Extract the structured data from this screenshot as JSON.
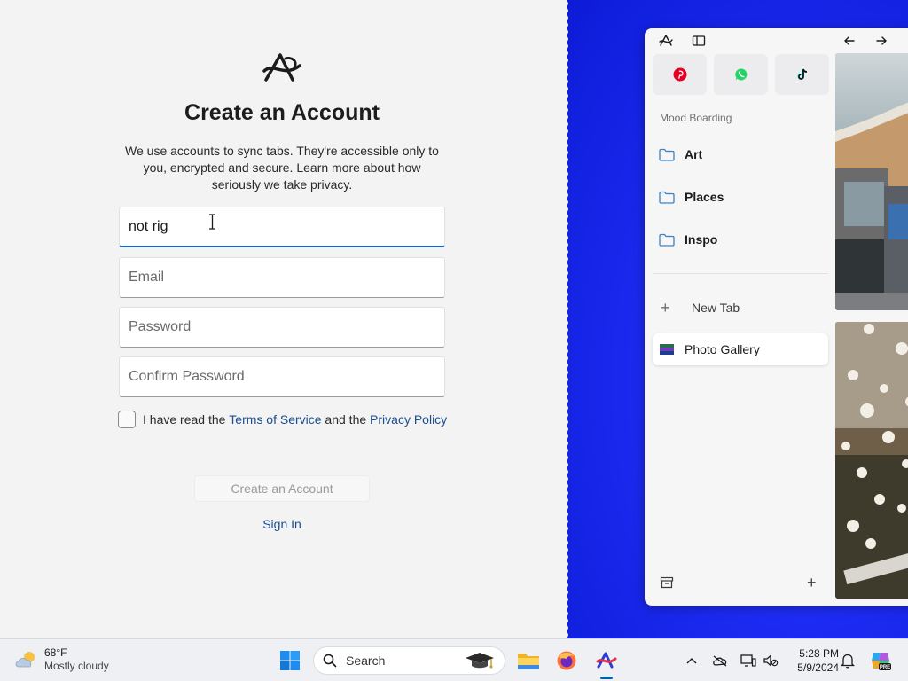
{
  "signup": {
    "title": "Create an Account",
    "description": "We use accounts to sync tabs. They're accessible only to you, encrypted and secure. Learn more about how seriously we take privacy.",
    "name_value": "not rig",
    "email_placeholder": "Email",
    "password_placeholder": "Password",
    "confirm_placeholder": "Confirm Password",
    "terms_prefix": "I have read the ",
    "terms_link": "Terms of Service",
    "terms_middle": " and the ",
    "privacy_link": "Privacy Policy",
    "create_button": "Create an Account",
    "sign_in": "Sign In"
  },
  "sidebar": {
    "section_label": "Mood Boarding",
    "folders": [
      {
        "label": "Art"
      },
      {
        "label": "Places"
      },
      {
        "label": "Inspo"
      }
    ],
    "new_tab_label": "New Tab",
    "active_tab": "Photo Gallery",
    "favorites": [
      "pinterest-icon",
      "whatsapp-icon",
      "tiktok-icon"
    ]
  },
  "taskbar": {
    "weather_temp": "68°F",
    "weather_condition": "Mostly cloudy",
    "search_label": "Search",
    "time": "5:28 PM",
    "date": "5/9/2024"
  },
  "colors": {
    "accent": "#1565c0",
    "link": "#1a4d8f",
    "desktop_blue": "#1d2bf2",
    "pinterest": "#e60023",
    "whatsapp": "#25d366"
  }
}
